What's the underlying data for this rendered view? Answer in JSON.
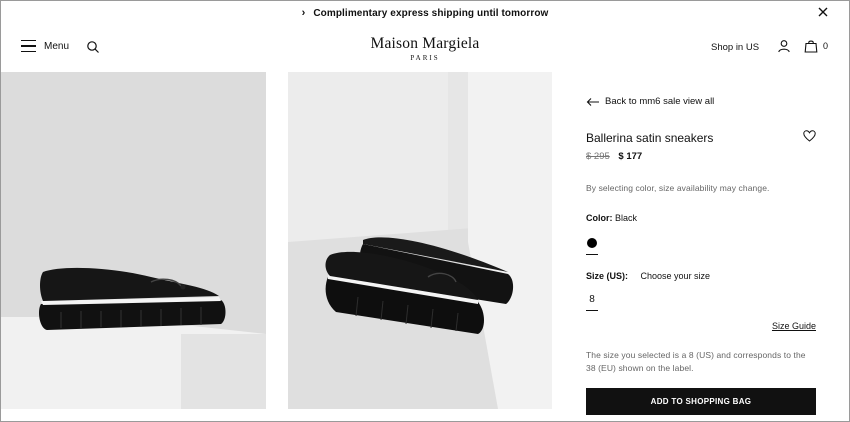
{
  "promo": {
    "text": "Complimentary express shipping until tomorrow",
    "chevron": "›"
  },
  "header": {
    "menu_label": "Menu",
    "logo_name": "Maison Margiela",
    "logo_sub": "PARIS",
    "shop_in": "Shop in US",
    "bag_count": "0"
  },
  "images": [
    {
      "name": "product-image-side",
      "icon": "sneaker-side-view"
    },
    {
      "name": "product-image-pair",
      "icon": "sneaker-pair-view"
    }
  ],
  "product": {
    "back_label": "Back to mm6 sale view all",
    "title": "Ballerina satin sneakers",
    "price_old": "$ 295",
    "price_new": "$ 177",
    "note": "By selecting color, size availability may change.",
    "color_label": "Color:",
    "color_value": "Black",
    "swatch_color": "#000000",
    "size_label": "Size (US):",
    "size_prompt": "Choose your size",
    "size_option": "8",
    "size_guide": "Size Guide",
    "size_info": "The size you selected is a 8 (US) and corresponds to the 38 (EU) shown on the label.",
    "add_to_bag": "ADD TO SHOPPING BAG"
  },
  "colors": {
    "accent": "#111111",
    "muted_text": "#666666"
  }
}
